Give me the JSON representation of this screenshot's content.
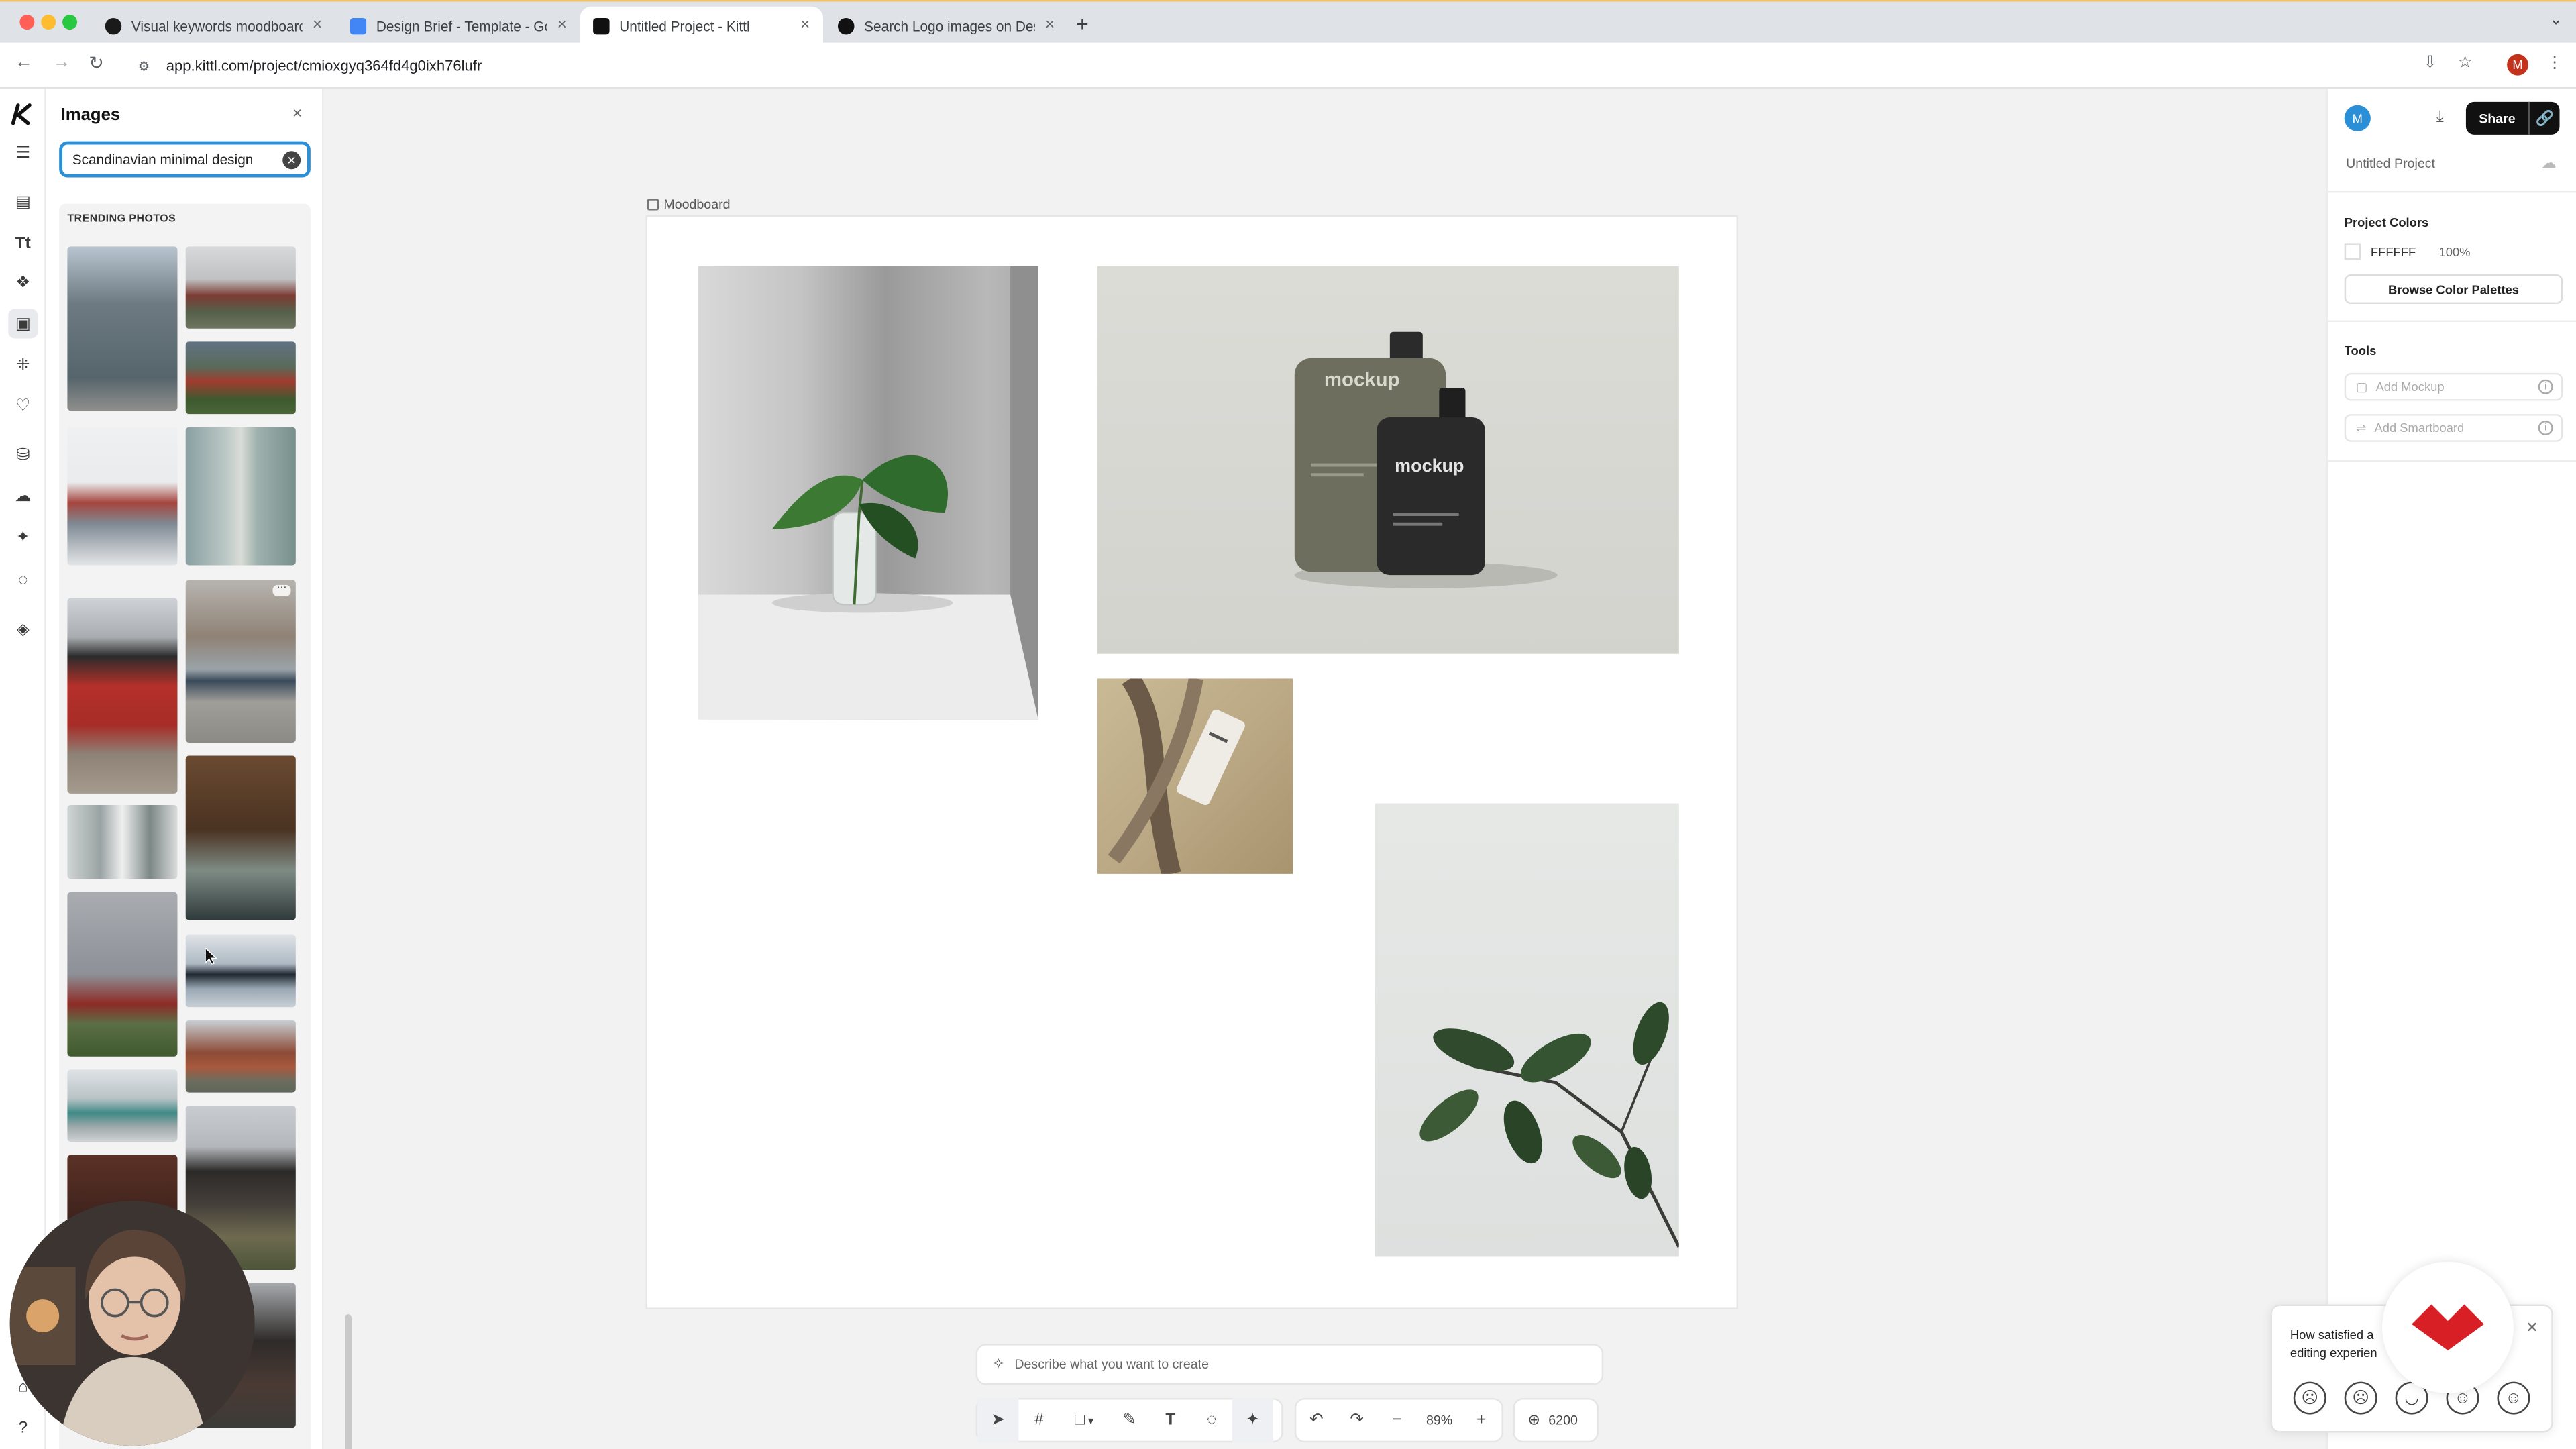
{
  "browser": {
    "tabs": [
      {
        "title": "Visual keywords moodboard",
        "icon": "kittl-icon",
        "active": false
      },
      {
        "title": "Design Brief - Template - Go",
        "icon": "google-docs-icon",
        "active": false
      },
      {
        "title": "Untitled Project - Kittl",
        "icon": "kittl-icon",
        "active": true
      },
      {
        "title": "Search Logo images on Desig",
        "icon": "design-site-icon",
        "active": false
      }
    ],
    "new_tab_glyph": "+",
    "url": "app.kittl.com/project/cmioxgyq364fd4g0ixh76lufr",
    "profile_initial": "M"
  },
  "left_panel": {
    "title": "Images",
    "close_glyph": "×",
    "search_value": "Scandinavian minimal design",
    "section_title": "TRENDING PHOTOS"
  },
  "canvas": {
    "artboard_label": "Moodboard",
    "images": [
      "plant-in-vase-photo",
      "mockup-bottles-photo",
      "mockup-tube-on-branch-photo",
      "leafy-branch-photo"
    ],
    "mockup_text_1": "mockup",
    "mockup_text_2": "mockup"
  },
  "right_panel": {
    "avatar_initial": "M",
    "share_label": "Share",
    "project_name": "Untitled Project",
    "project_colors_title": "Project Colors",
    "color_hex": "FFFFFF",
    "color_opacity": "100%",
    "browse_label": "Browse Color Palettes",
    "tools_title": "Tools",
    "tool_1": "Add Mockup",
    "tool_2": "Add Smartboard"
  },
  "bottom": {
    "prompt_placeholder": "Describe what you want to create",
    "zoom": "89%",
    "credits": "6200"
  },
  "feedback": {
    "question": "How satisfied a editing experien"
  },
  "colors": {
    "accent": "#2d8fd5",
    "brand_red": "#d81f26",
    "avatar_blue": "#2a8fd6"
  }
}
